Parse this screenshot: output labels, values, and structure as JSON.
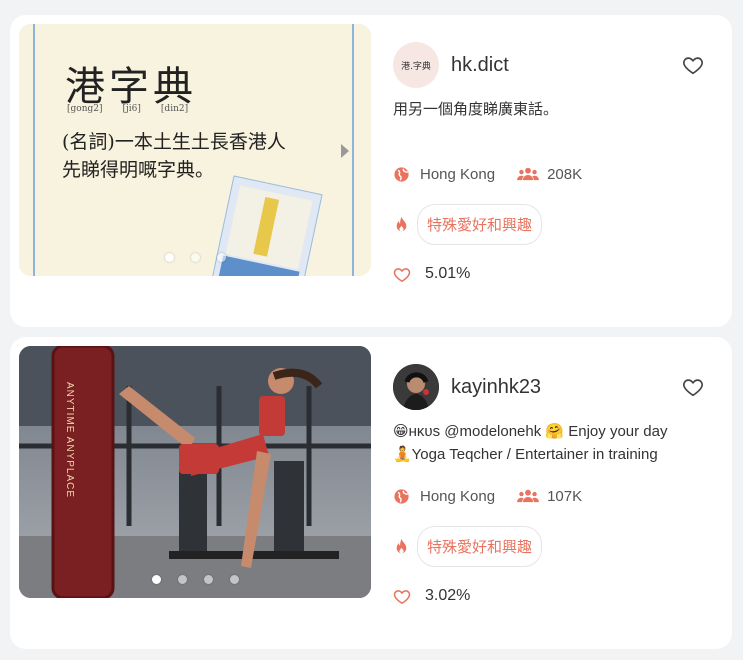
{
  "accent": "#e8735f",
  "cards": [
    {
      "handle": "hk.dict",
      "avatar_text": "港.字典",
      "bio_lines": [
        "用另一個角度睇廣東話。"
      ],
      "location": "Hong Kong",
      "followers": "208K",
      "category": "特殊愛好和興趣",
      "engagement": "5.01%",
      "image": {
        "title": "港字典",
        "pinyin": [
          "[gong2]",
          "[ji6]",
          "[din2]"
        ],
        "line1": "(名詞)一本土生土長香港人",
        "line2": "先睇得明嘅字典。"
      },
      "carousel": {
        "count": 3,
        "active": 0
      }
    },
    {
      "handle": "kayinhk23",
      "bio_lines": [
        "😁ʜᴋᴜs @modelonehk 🤗 Enjoy your day",
        "🧘Yoga Teqcher / Entertainer in training"
      ],
      "location": "Hong Kong",
      "followers": "107K",
      "category": "特殊愛好和興趣",
      "engagement": "3.02%",
      "image": {
        "bag_text": "ANYTIME ANYPLACE"
      },
      "carousel": {
        "count": 4,
        "active": 0
      }
    }
  ]
}
